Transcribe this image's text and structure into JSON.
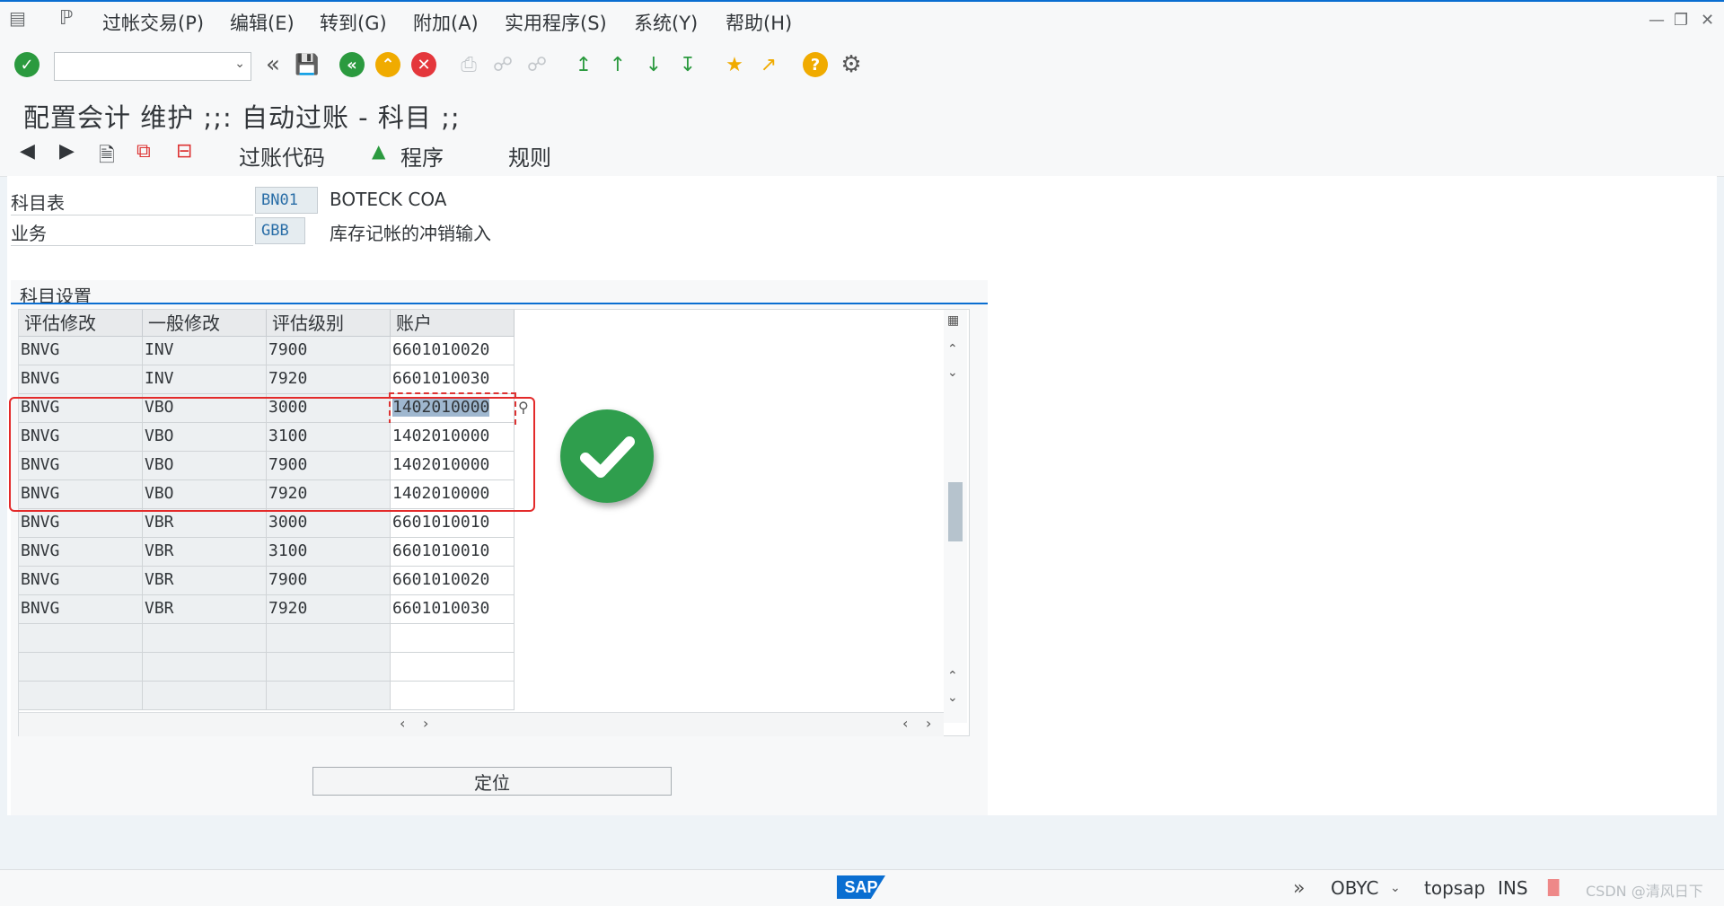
{
  "menubar": {
    "items": [
      "过帐交易(P)",
      "编辑(E)",
      "转到(G)",
      "附加(A)",
      "实用程序(S)",
      "系统(Y)",
      "帮助(H)"
    ]
  },
  "toolbar": {
    "command_field_value": "",
    "icons": [
      "enter-icon",
      "back-double-icon",
      "save-icon",
      "back-icon",
      "exit-icon",
      "cancel-icon",
      "print-icon",
      "find-icon",
      "find-next-icon",
      "first-page-icon",
      "prev-page-icon",
      "next-page-icon",
      "last-page-icon",
      "create-session-icon",
      "shortcut-icon",
      "help-icon",
      "settings-icon"
    ]
  },
  "title": "配置会计 维护 ;;: 自动过账 - 科目 ;;",
  "app_toolbar": {
    "posting_keys": "过账代码",
    "procedures": "程序",
    "rules": "规则"
  },
  "header": {
    "chart_label": "科目表",
    "chart_value": "BN01",
    "chart_desc": "BOTECK COA",
    "transaction_label": "业务",
    "transaction_value": "GBB",
    "transaction_desc": "库存记帐的冲销输入"
  },
  "group": {
    "title": "科目设置",
    "columns": [
      "评估修改",
      "一般修改",
      "评估级别",
      "账户"
    ],
    "rows": [
      [
        "BNVG",
        "INV",
        "7900",
        "6601010020"
      ],
      [
        "BNVG",
        "INV",
        "7920",
        "6601010030"
      ],
      [
        "BNVG",
        "VBO",
        "3000",
        "1402010000"
      ],
      [
        "BNVG",
        "VBO",
        "3100",
        "1402010000"
      ],
      [
        "BNVG",
        "VBO",
        "7900",
        "1402010000"
      ],
      [
        "BNVG",
        "VBO",
        "7920",
        "1402010000"
      ],
      [
        "BNVG",
        "VBR",
        "3000",
        "6601010010"
      ],
      [
        "BNVG",
        "VBR",
        "3100",
        "6601010010"
      ],
      [
        "BNVG",
        "VBR",
        "7900",
        "6601010020"
      ],
      [
        "BNVG",
        "VBR",
        "7920",
        "6601010030"
      ],
      [
        "",
        "",
        "",
        ""
      ],
      [
        "",
        "",
        "",
        ""
      ],
      [
        "",
        "",
        "",
        ""
      ]
    ],
    "selected_row": 2,
    "locate_button": "定位"
  },
  "status": {
    "transaction": "OBYC",
    "system": "topsap",
    "mode": "INS",
    "watermark": "CSDN @清风日下"
  },
  "colors": {
    "accent": "#0a6ed1",
    "highlight_border": "#e32a2a",
    "check_green": "#2f9e4d"
  }
}
